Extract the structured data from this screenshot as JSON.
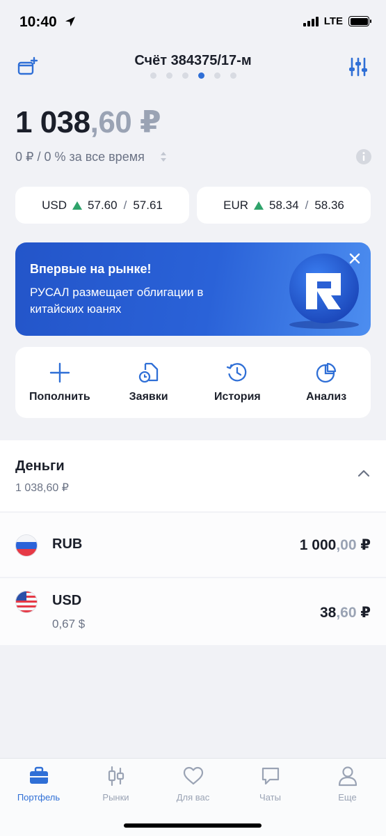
{
  "status_bar": {
    "time": "10:40",
    "network": "LTE"
  },
  "header": {
    "title": "Счёт 384375/17-м",
    "page_count": 6,
    "active_page": 4
  },
  "balance": {
    "whole": "1 038",
    "fraction": ",60 ₽",
    "pnl_text": "0 ₽ / 0 % за все время"
  },
  "rates": [
    {
      "currency": "USD",
      "bid": "57.60",
      "separator": "/",
      "ask": "57.61",
      "trend": "up"
    },
    {
      "currency": "EUR",
      "bid": "58.34",
      "separator": "/",
      "ask": "58.36",
      "trend": "up"
    }
  ],
  "banner": {
    "title": "Впервые на рынке!",
    "text": "РУСАЛ размещает облигации в китайских юанях"
  },
  "actions": [
    {
      "label": "Пополнить",
      "icon": "plus-icon"
    },
    {
      "label": "Заявки",
      "icon": "orders-icon"
    },
    {
      "label": "История",
      "icon": "history-icon"
    },
    {
      "label": "Анализ",
      "icon": "pie-chart-icon"
    }
  ],
  "money": {
    "title": "Деньги",
    "total": "1 038,60 ₽",
    "items": [
      {
        "code": "RUB",
        "sub": "",
        "value_whole": "1 000",
        "value_frac": ",00",
        "currency_sign": " ₽",
        "flag": "russia-flag-icon"
      },
      {
        "code": "USD",
        "sub": "0,67 $",
        "value_whole": "38",
        "value_frac": ",60",
        "currency_sign": " ₽",
        "flag": "usa-flag-icon"
      }
    ]
  },
  "tabs": [
    {
      "label": "Портфель",
      "icon": "briefcase-icon",
      "active": true
    },
    {
      "label": "Рынки",
      "icon": "candlestick-icon",
      "active": false
    },
    {
      "label": "Для вас",
      "icon": "heart-icon",
      "active": false
    },
    {
      "label": "Чаты",
      "icon": "chat-icon",
      "active": false
    },
    {
      "label": "Еще",
      "icon": "profile-icon",
      "active": false
    }
  ],
  "colors": {
    "accent": "#2f6fd6",
    "up": "#2fa36b",
    "banner": "#2a62d8",
    "muted": "#9aa3b4"
  }
}
